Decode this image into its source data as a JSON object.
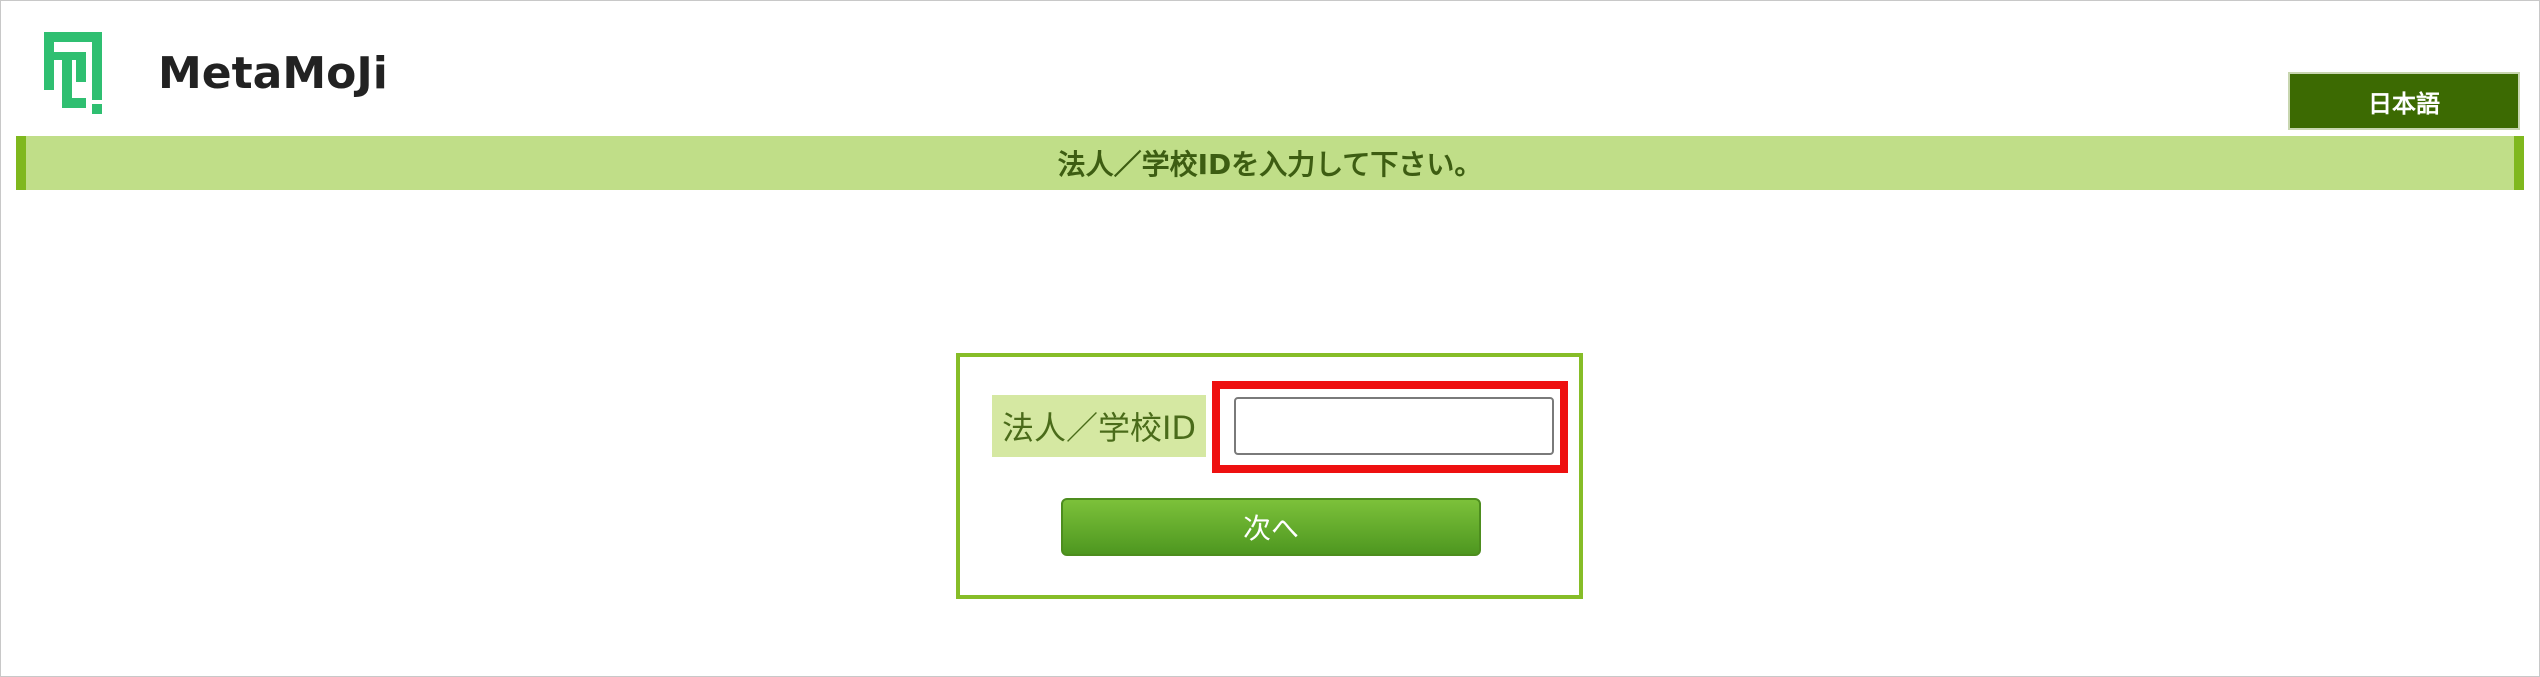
{
  "header": {
    "brand_name": "MetaMoJi",
    "logo_icon": "metamoji-logo-icon",
    "language_button_label": "日本語"
  },
  "banner": {
    "text": "法人／学校IDを入力して下さい。"
  },
  "form": {
    "id_label": "法人／学校ID",
    "id_input_value": "",
    "next_button_label": "次へ"
  },
  "colors": {
    "logo_green": "#2fbf71",
    "language_button_bg": "#3c6a02",
    "banner_bg": "#c0de88",
    "banner_accent": "#7fb81e",
    "form_border": "#86bd28",
    "label_bg": "#d5e8a2",
    "highlight_red": "#ee1010",
    "button_green": "#5ea62a"
  }
}
